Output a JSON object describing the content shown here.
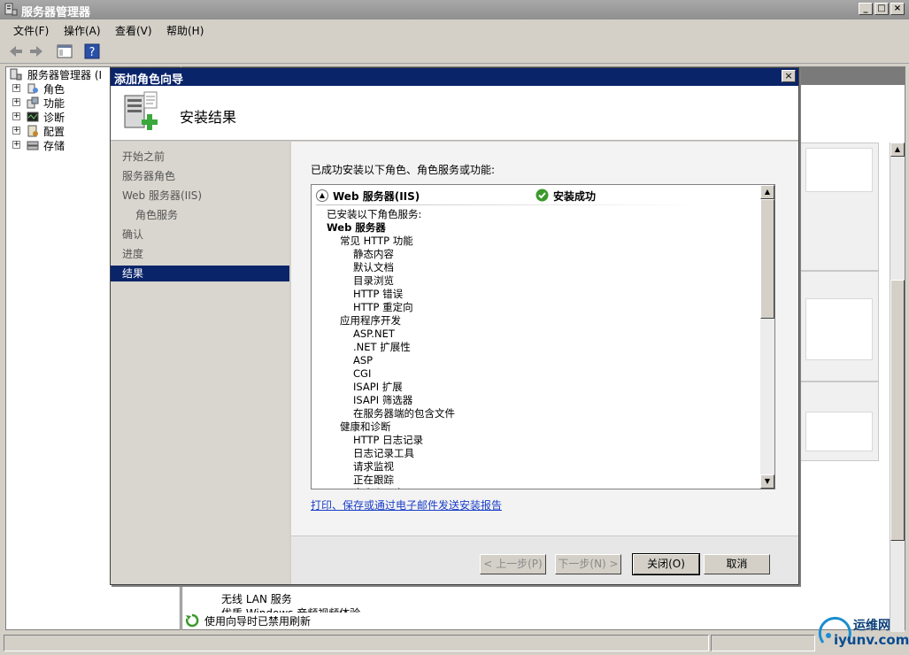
{
  "window": {
    "title": "服务器管理器",
    "controls": [
      "_",
      "□",
      "×"
    ]
  },
  "menu": [
    {
      "label": "文件(F)"
    },
    {
      "label": "操作(A)"
    },
    {
      "label": "查看(V)"
    },
    {
      "label": "帮助(H)"
    }
  ],
  "tree": {
    "root": "服务器管理器 (I",
    "items": [
      {
        "label": "角色",
        "icon": "roles-icon"
      },
      {
        "label": "功能",
        "icon": "features-icon"
      },
      {
        "label": "诊断",
        "icon": "diagnostics-icon"
      },
      {
        "label": "配置",
        "icon": "configuration-icon"
      },
      {
        "label": "存储",
        "icon": "storage-icon"
      }
    ]
  },
  "background": {
    "list_item_1": "无线 LAN 服务",
    "list_item_2": "优质 Windows 音频视频体验",
    "refresh_text": "使用向导时已禁用刷新"
  },
  "dialog": {
    "title": "添加角色向导",
    "close": "×",
    "header": "安装结果",
    "nav": [
      {
        "label": "开始之前",
        "active": false,
        "indent": false
      },
      {
        "label": "服务器角色",
        "active": false,
        "indent": false
      },
      {
        "label": "Web 服务器(IIS)",
        "active": false,
        "indent": false
      },
      {
        "label": "角色服务",
        "active": false,
        "indent": true
      },
      {
        "label": "确认",
        "active": false,
        "indent": false
      },
      {
        "label": "进度",
        "active": false,
        "indent": false
      },
      {
        "label": "结果",
        "active": true,
        "indent": false
      }
    ],
    "intro": "已成功安装以下角色、角色服务或功能:",
    "result": {
      "role": "Web 服务器(IIS)",
      "status": "安装成功",
      "details": [
        {
          "text": "已安装以下角色服务:",
          "level": 0,
          "bold": false
        },
        {
          "text": "Web 服务器",
          "level": 0,
          "bold": true
        },
        {
          "text": "常见 HTTP 功能",
          "level": 1,
          "bold": false
        },
        {
          "text": "静态内容",
          "level": 2,
          "bold": false
        },
        {
          "text": "默认文档",
          "level": 2,
          "bold": false
        },
        {
          "text": "目录浏览",
          "level": 2,
          "bold": false
        },
        {
          "text": "HTTP 错误",
          "level": 2,
          "bold": false
        },
        {
          "text": "HTTP 重定向",
          "level": 2,
          "bold": false
        },
        {
          "text": "应用程序开发",
          "level": 1,
          "bold": false
        },
        {
          "text": "ASP.NET",
          "level": 2,
          "bold": false
        },
        {
          "text": ".NET 扩展性",
          "level": 2,
          "bold": false
        },
        {
          "text": "ASP",
          "level": 2,
          "bold": false
        },
        {
          "text": "CGI",
          "level": 2,
          "bold": false
        },
        {
          "text": "ISAPI 扩展",
          "level": 2,
          "bold": false
        },
        {
          "text": "ISAPI 筛选器",
          "level": 2,
          "bold": false
        },
        {
          "text": "在服务器端的包含文件",
          "level": 2,
          "bold": false
        },
        {
          "text": "健康和诊断",
          "level": 1,
          "bold": false
        },
        {
          "text": "HTTP 日志记录",
          "level": 2,
          "bold": false
        },
        {
          "text": "日志记录工具",
          "level": 2,
          "bold": false
        },
        {
          "text": "请求监视",
          "level": 2,
          "bold": false
        },
        {
          "text": "正在跟踪",
          "level": 2,
          "bold": false
        },
        {
          "text": "自定义日志",
          "level": 2,
          "bold": false
        }
      ]
    },
    "report_link": "打印、保存或通过电子邮件发送安装报告",
    "buttons": {
      "prev": "< 上一步(P)",
      "next": "下一步(N) >",
      "close": "关闭(O)",
      "cancel": "取消"
    }
  },
  "watermark": {
    "line1": "运维网",
    "line2": "iyunv.com"
  },
  "colors": {
    "dialog_title": "#0a246a",
    "active_nav": "#0a246a",
    "link": "#1a3ec8",
    "success": "#3a9a2a"
  }
}
